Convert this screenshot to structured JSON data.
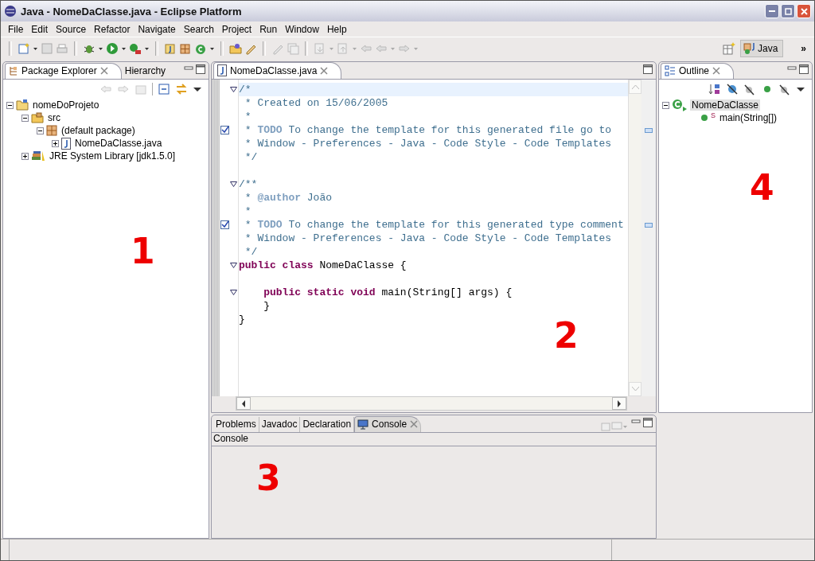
{
  "window": {
    "title": "Java - NomeDaClasse.java - Eclipse Platform"
  },
  "menu": [
    "File",
    "Edit",
    "Source",
    "Refactor",
    "Navigate",
    "Search",
    "Project",
    "Run",
    "Window",
    "Help"
  ],
  "perspective": {
    "label": "Java",
    "selected": true,
    "more": "»"
  },
  "left_panel": {
    "tabs": [
      {
        "label": "Package Explorer",
        "selected": true
      },
      {
        "label": "Hierarchy",
        "selected": false
      }
    ],
    "tree": [
      {
        "label": "nomeDoProjeto",
        "kind": "project",
        "expanded": true,
        "children": [
          {
            "label": "src",
            "kind": "source-folder",
            "expanded": true,
            "children": [
              {
                "label": "(default package)",
                "kind": "package",
                "expanded": true,
                "children": [
                  {
                    "label": "NomeDaClasse.java",
                    "kind": "java-file",
                    "expanded": false
                  }
                ]
              }
            ]
          },
          {
            "label": "JRE System Library [jdk1.5.0]",
            "kind": "library",
            "expanded": false
          }
        ]
      }
    ],
    "annotation": "1"
  },
  "editor": {
    "tab": {
      "label": "NomeDaClasse.java",
      "selected": true
    },
    "annotation": "2",
    "lines": [
      {
        "fold": true,
        "task": false,
        "segments": [
          {
            "kind": "comment",
            "text": "/*"
          }
        ]
      },
      {
        "fold": false,
        "task": false,
        "segments": [
          {
            "kind": "comment",
            "text": " * Created on 15/06/2005"
          }
        ]
      },
      {
        "fold": false,
        "task": false,
        "segments": [
          {
            "kind": "comment",
            "text": " *"
          }
        ]
      },
      {
        "fold": false,
        "task": true,
        "segments": [
          {
            "kind": "comment",
            "text": " * "
          },
          {
            "kind": "tag",
            "text": "TODO"
          },
          {
            "kind": "comment",
            "text": " To change the template for this generated file go to"
          }
        ]
      },
      {
        "fold": false,
        "task": false,
        "segments": [
          {
            "kind": "comment",
            "text": " * Window - Preferences - Java - Code Style - Code Templates"
          }
        ]
      },
      {
        "fold": false,
        "task": false,
        "segments": [
          {
            "kind": "comment",
            "text": " */"
          }
        ]
      },
      {
        "fold": false,
        "task": false
      },
      {
        "fold": true,
        "task": false,
        "segments": [
          {
            "kind": "comment",
            "text": "/**"
          }
        ]
      },
      {
        "fold": false,
        "task": false,
        "segments": [
          {
            "kind": "comment",
            "text": " * "
          },
          {
            "kind": "tag",
            "text": "@author"
          },
          {
            "kind": "comment",
            "text": " João"
          }
        ]
      },
      {
        "fold": false,
        "task": false,
        "segments": [
          {
            "kind": "comment",
            "text": " *"
          }
        ]
      },
      {
        "fold": false,
        "task": true,
        "segments": [
          {
            "kind": "comment",
            "text": " * "
          },
          {
            "kind": "tag",
            "text": "TODO"
          },
          {
            "kind": "comment",
            "text": " To change the template for this generated type comment"
          }
        ]
      },
      {
        "fold": false,
        "task": false,
        "segments": [
          {
            "kind": "comment",
            "text": " * Window - Preferences - Java - Code Style - Code Templates"
          }
        ]
      },
      {
        "fold": false,
        "task": false,
        "segments": [
          {
            "kind": "comment",
            "text": " */"
          }
        ]
      },
      {
        "fold": true,
        "task": false,
        "segments": [
          {
            "kind": "keyword",
            "text": "public class"
          },
          {
            "kind": "plain",
            "text": " NomeDaClasse {"
          }
        ]
      },
      {
        "fold": false,
        "task": false
      },
      {
        "fold": true,
        "task": false,
        "segments": [
          {
            "kind": "keyword",
            "text": "    public static void"
          },
          {
            "kind": "plain",
            "text": " main(String[] args) {"
          }
        ]
      },
      {
        "fold": false,
        "task": false,
        "segments": [
          {
            "kind": "plain",
            "text": "    }"
          }
        ]
      },
      {
        "fold": false,
        "task": false,
        "segments": [
          {
            "kind": "plain",
            "text": "}"
          }
        ]
      }
    ]
  },
  "outline": {
    "tab": {
      "label": "Outline",
      "selected": true
    },
    "annotation": "4",
    "tree": [
      {
        "label": "NomeDaClasse",
        "kind": "class",
        "expanded": true,
        "selected": true,
        "children": [
          {
            "label": "main(String[])",
            "kind": "method",
            "selected": false,
            "static_mark": "S"
          }
        ]
      }
    ]
  },
  "bottom_panel": {
    "tabs": [
      {
        "label": "Problems",
        "selected": false
      },
      {
        "label": "Javadoc",
        "selected": false
      },
      {
        "label": "Declaration",
        "selected": false
      },
      {
        "label": "Console",
        "selected": true
      }
    ],
    "title": "Console",
    "annotation": "3"
  }
}
